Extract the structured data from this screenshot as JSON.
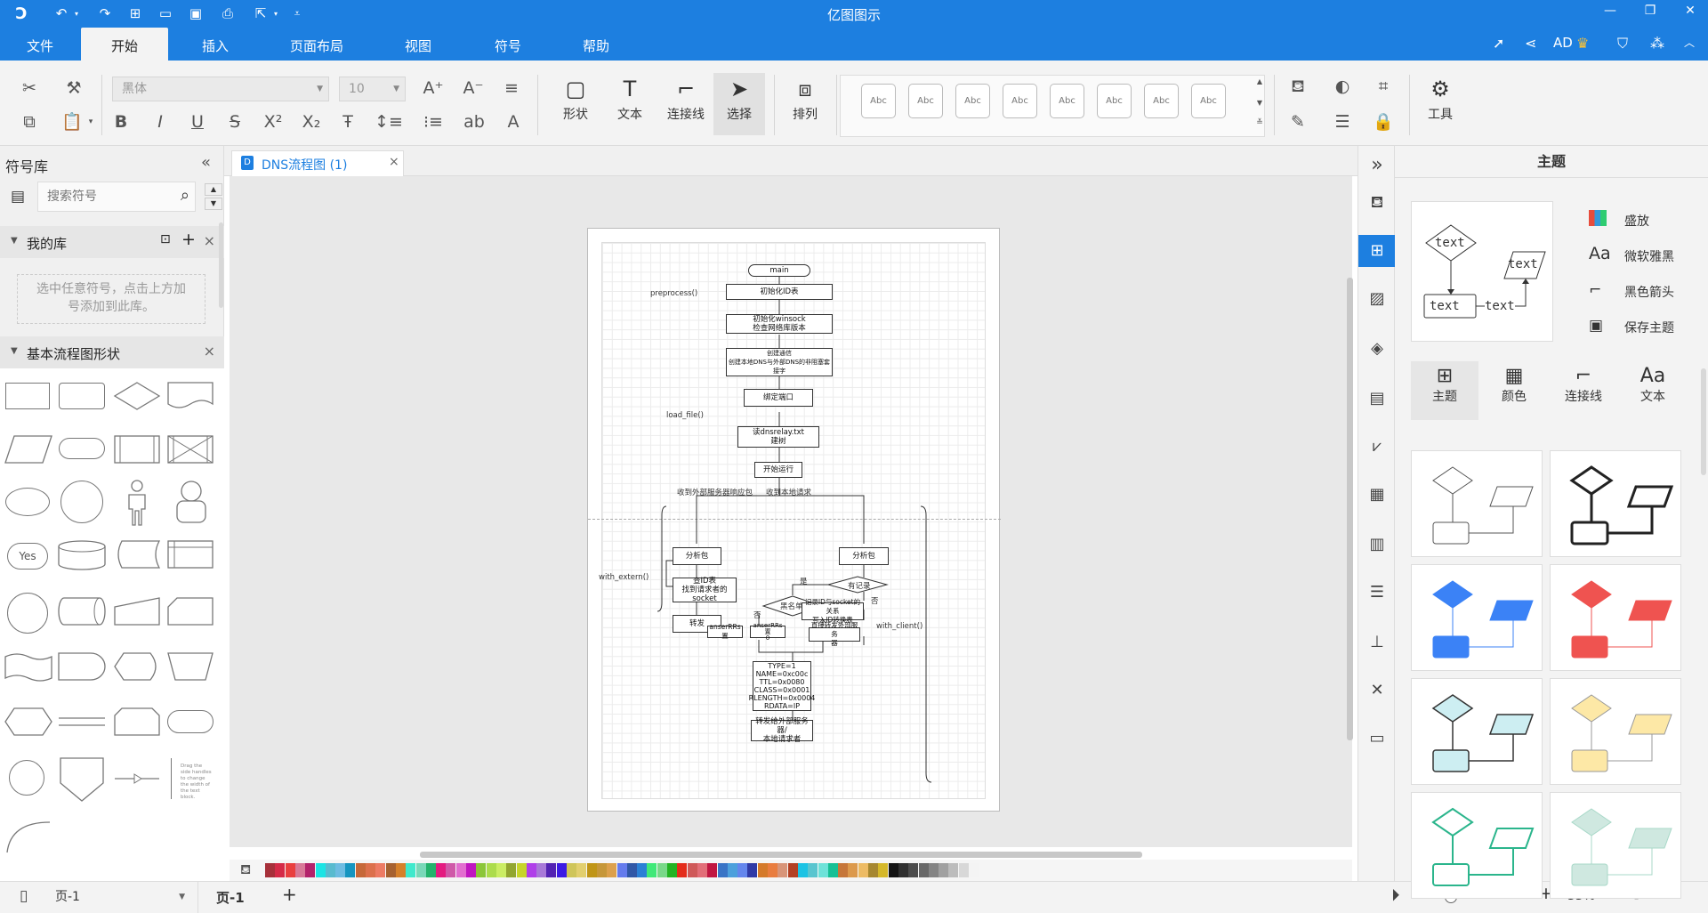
{
  "app": {
    "title": "亿图图示"
  },
  "menu": {
    "tabs": [
      "文件",
      "开始",
      "插入",
      "页面布局",
      "视图",
      "符号",
      "帮助"
    ],
    "active": "开始",
    "user": "AD"
  },
  "ribbon": {
    "font_name": "黑体",
    "font_size": "10",
    "big_buttons": {
      "shape": "形状",
      "text": "文本",
      "connector": "连接线",
      "select": "选择",
      "arrange": "排列",
      "tools": "工具"
    },
    "style_box_label": "Abc"
  },
  "left_panel": {
    "title": "符号库",
    "search_placeholder": "搜索符号",
    "my_library": "我的库",
    "my_library_hint_1": "选中任意符号，点击上方加",
    "my_library_hint_2": "号添加到此库。",
    "basic_flow": "基本流程图形状",
    "yes_label": "Yes",
    "note_text": "Drag the side handles to change the width of the text block."
  },
  "document": {
    "tab_title": "DNS流程图 (1)"
  },
  "flowchart": {
    "main": "main",
    "init": "初始化ID表",
    "winsock_1": "初始化winsock",
    "winsock_2": "检查网络库版本",
    "socket_1": "创建通信",
    "socket_2": "创建本地DNS与外部DNS的非阻塞套接字",
    "bind": "绑定端口",
    "read_1": "读dnsrelay.txt",
    "read_2": "建树",
    "start": "开始运行",
    "preprocess": "preprocess()",
    "load_file": "load_file()",
    "from_ext": "收到外部服务器响应包",
    "from_local": "收到本地请求",
    "parse": "分析包",
    "lookup_1": "查ID表",
    "lookup_2": "找到请求者的socket",
    "forward": "转发",
    "blacklist": "黑名单",
    "has_record": "有记录",
    "record_1": "记录ID与socket的关系",
    "record_2": "写入ID转换表",
    "fwd_ext_1": "直接转发外部服务",
    "fwd_ext_2": "器",
    "ans_1": "anserRRs置",
    "ans_2": "anserRRs置",
    "ans_3": "0",
    "yes": "是",
    "no": "否",
    "with_extern": "with_extern()",
    "with_client": "with_client()",
    "rr_1": "TYPE=1",
    "rr_2": "NAME=0xc00c",
    "rr_3": "TTL=0x0080",
    "rr_4": "CLASS=0x0001",
    "rr_5": "RLENGTH=0x0004",
    "rr_6": "RDATA=IP",
    "final_1": "转发给外部服务器/",
    "final_2": "本地请求者"
  },
  "right_panel": {
    "title": "主题",
    "preview_text": "text",
    "opt_1": "盛放",
    "opt_2": "微软雅黑",
    "opt_3": "黑色箭头",
    "opt_4": "保存主题",
    "tabs": [
      "主题",
      "颜色",
      "连接线",
      "文本"
    ]
  },
  "status": {
    "page_select": "页-1",
    "page_tab": "页-1",
    "zoom": "33%"
  },
  "colors": {
    "accent": "#1d7fe0"
  }
}
